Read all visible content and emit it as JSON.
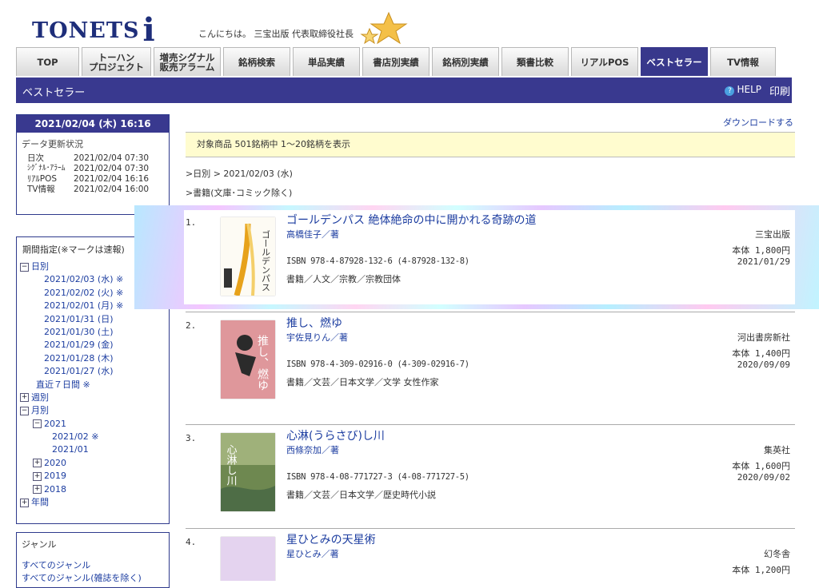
{
  "header": {
    "logo": "TONETS",
    "logo_i": "i",
    "greeting": "こんにちは。 三宝出版 代表取締役社長"
  },
  "tabs": [
    {
      "label": "TOP",
      "active": false
    },
    {
      "label": "トーハン\nプロジェクト",
      "active": false
    },
    {
      "label": "増売シグナル\n販売アラーム",
      "active": false
    },
    {
      "label": "銘柄検索",
      "active": false
    },
    {
      "label": "単品実績",
      "active": false
    },
    {
      "label": "書店別実績",
      "active": false
    },
    {
      "label": "銘柄別実績",
      "active": false
    },
    {
      "label": "類書比較",
      "active": false
    },
    {
      "label": "リアルPOS",
      "active": false
    },
    {
      "label": "ベストセラー",
      "active": true
    },
    {
      "label": "TV情報",
      "active": false
    }
  ],
  "titlebar": {
    "title": "ベストセラー",
    "help": "HELP",
    "print": "印刷"
  },
  "status_panel": {
    "datetime": "2021/02/04 (木) 16:16",
    "update_label": "データ更新状況",
    "rows": [
      {
        "k": "日次",
        "v": "2021/02/04 07:30"
      },
      {
        "k": "ｼｸﾞﾅﾙ･ｱﾗｰﾑ",
        "v": "2021/02/04 07:30"
      },
      {
        "k": "ﾘｱﾙPOS",
        "v": "2021/02/04 16:16"
      },
      {
        "k": "TV情報",
        "v": "2021/02/04 16:00"
      }
    ]
  },
  "period_panel": {
    "heading": "期間指定(※マークは速報)",
    "daily_label": "日別",
    "days": [
      "2021/02/03 (水) ※",
      "2021/02/02 (火) ※",
      "2021/02/01 (月) ※",
      "2021/01/31 (日)",
      "2021/01/30 (土)",
      "2021/01/29 (金)",
      "2021/01/28 (木)",
      "2021/01/27 (水)"
    ],
    "recent7": "直近７日間 ※",
    "weekly_label": "週別",
    "monthly_label": "月別",
    "y2021": "2021",
    "m202102": "2021/02 ※",
    "m202101": "2021/01",
    "y2020": "2020",
    "y2019": "2019",
    "y2018": "2018",
    "yearly_label": "年間"
  },
  "genre_panel": {
    "heading": "ジャンル",
    "links": [
      "すべてのジャンル",
      "すべてのジャンル(雑誌を除く)"
    ]
  },
  "download": "ダウンロードする",
  "info": "対象商品 501銘柄中 1～20銘柄を表示",
  "breadcrumb1": ">日別 > 2021/02/03 (水)",
  "breadcrumb2": ">書籍(文庫･コミック除く)",
  "items": [
    {
      "num": "1.",
      "title": "ゴールデンパス 絶体絶命の中に開かれる奇跡の道",
      "author": "高橋佳子／著",
      "isbn": "ISBN 978-4-87928-132-6 (4-87928-132-8)",
      "genre": "書籍／人文／宗教／宗教団体",
      "publisher": "三宝出版",
      "price": "本体 1,800円",
      "date": "2021/01/29",
      "cover_text": "ゴールデンパス"
    },
    {
      "num": "2.",
      "title": "推し、燃ゆ",
      "author": "宇佐見りん／著",
      "isbn": "ISBN 978-4-309-02916-0 (4-309-02916-7)",
      "genre": "書籍／文芸／日本文学／文学 女性作家",
      "publisher": "河出書房新社",
      "price": "本体 1,400円",
      "date": "2020/09/09",
      "cover_text": "推し、燃ゆ"
    },
    {
      "num": "3.",
      "title": "心淋(うらさび)し川",
      "author": "西條奈加／著",
      "isbn": "ISBN 978-4-08-771727-3 (4-08-771727-5)",
      "genre": "書籍／文芸／日本文学／歴史時代小説",
      "publisher": "集英社",
      "price": "本体 1,600円",
      "date": "2020/09/02",
      "cover_text": "心淋し川"
    },
    {
      "num": "4.",
      "title": "星ひとみの天星術",
      "author": "星ひとみ／著",
      "isbn": "",
      "genre": "",
      "publisher": "幻冬舎",
      "price": "本体 1,200円",
      "date": "",
      "cover_text": ""
    }
  ]
}
